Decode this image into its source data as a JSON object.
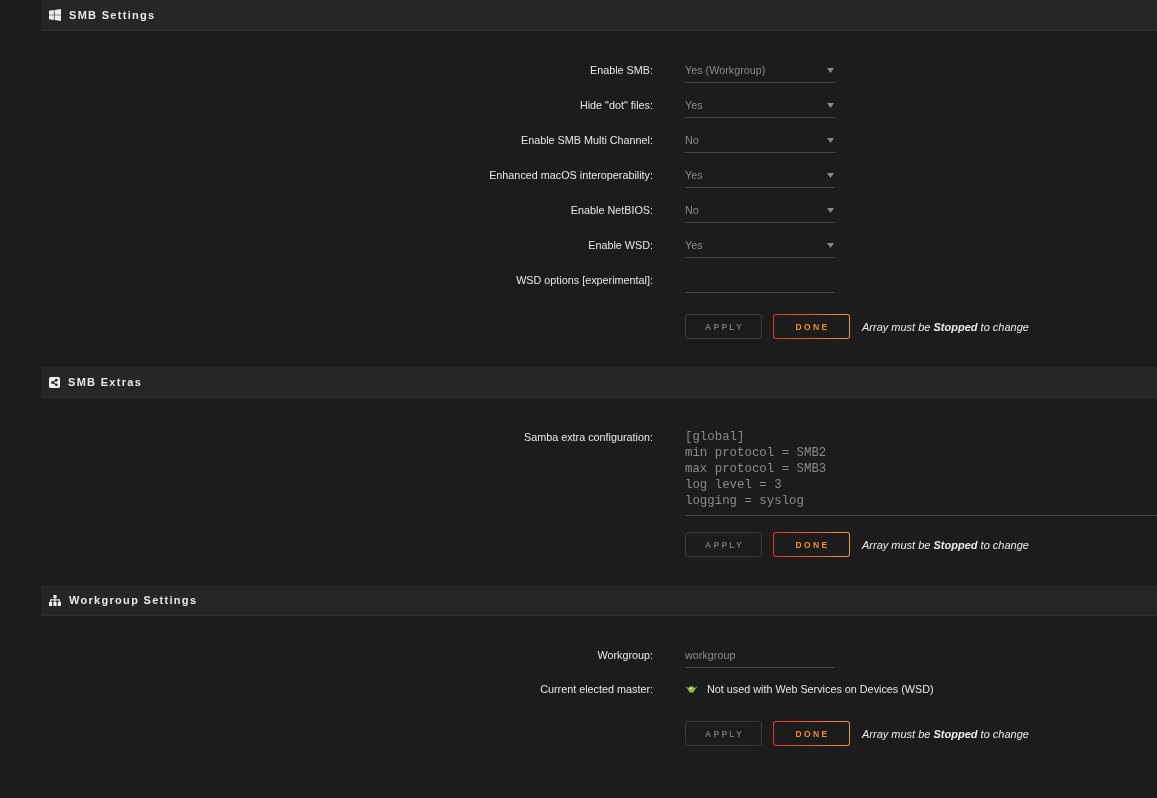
{
  "sections": [
    {
      "title": "SMB Settings",
      "fields": [
        {
          "kind": "select",
          "label": "Enable SMB:",
          "value": "Yes (Workgroup)"
        },
        {
          "kind": "select",
          "label": "Hide \"dot\" files:",
          "value": "Yes"
        },
        {
          "kind": "select",
          "label": "Enable SMB Multi Channel:",
          "value": "No"
        },
        {
          "kind": "select",
          "label": "Enhanced macOS interoperability:",
          "value": "Yes"
        },
        {
          "kind": "select",
          "label": "Enable NetBIOS:",
          "value": "No"
        },
        {
          "kind": "select",
          "label": "Enable WSD:",
          "value": "Yes"
        },
        {
          "kind": "text",
          "label": "WSD options [experimental]:"
        }
      ],
      "buttons": [
        {
          "label": "APPLY",
          "disabled": true
        },
        {
          "label": "DONE",
          "disabled": false
        }
      ],
      "note": "Array must be **Stopped** to change"
    },
    {
      "title": "SMB Extras",
      "fields": [
        {
          "kind": "textarea",
          "label": "Samba extra configuration:",
          "lines": [
            "[global]",
            "min protocol = SMB2",
            "max protocol = SMB3",
            "log level = 3",
            "logging = syslog"
          ]
        }
      ],
      "buttons": [
        {
          "label": "APPLY",
          "disabled": true
        },
        {
          "label": "DONE",
          "disabled": false
        }
      ],
      "note": "Array must be **Stopped** to change"
    },
    {
      "title": "Workgroup Settings",
      "fields": [
        {
          "kind": "text",
          "label": "Workgroup:",
          "value": "workgroup"
        },
        {
          "kind": "status",
          "label": "Current elected master:",
          "text": "Not used with Web Services on Devices (WSD)"
        }
      ],
      "buttons": [
        {
          "label": "APPLY",
          "disabled": true
        },
        {
          "label": "DONE",
          "disabled": false
        }
      ],
      "note": "Array must be **Stopped** to change"
    }
  ]
}
